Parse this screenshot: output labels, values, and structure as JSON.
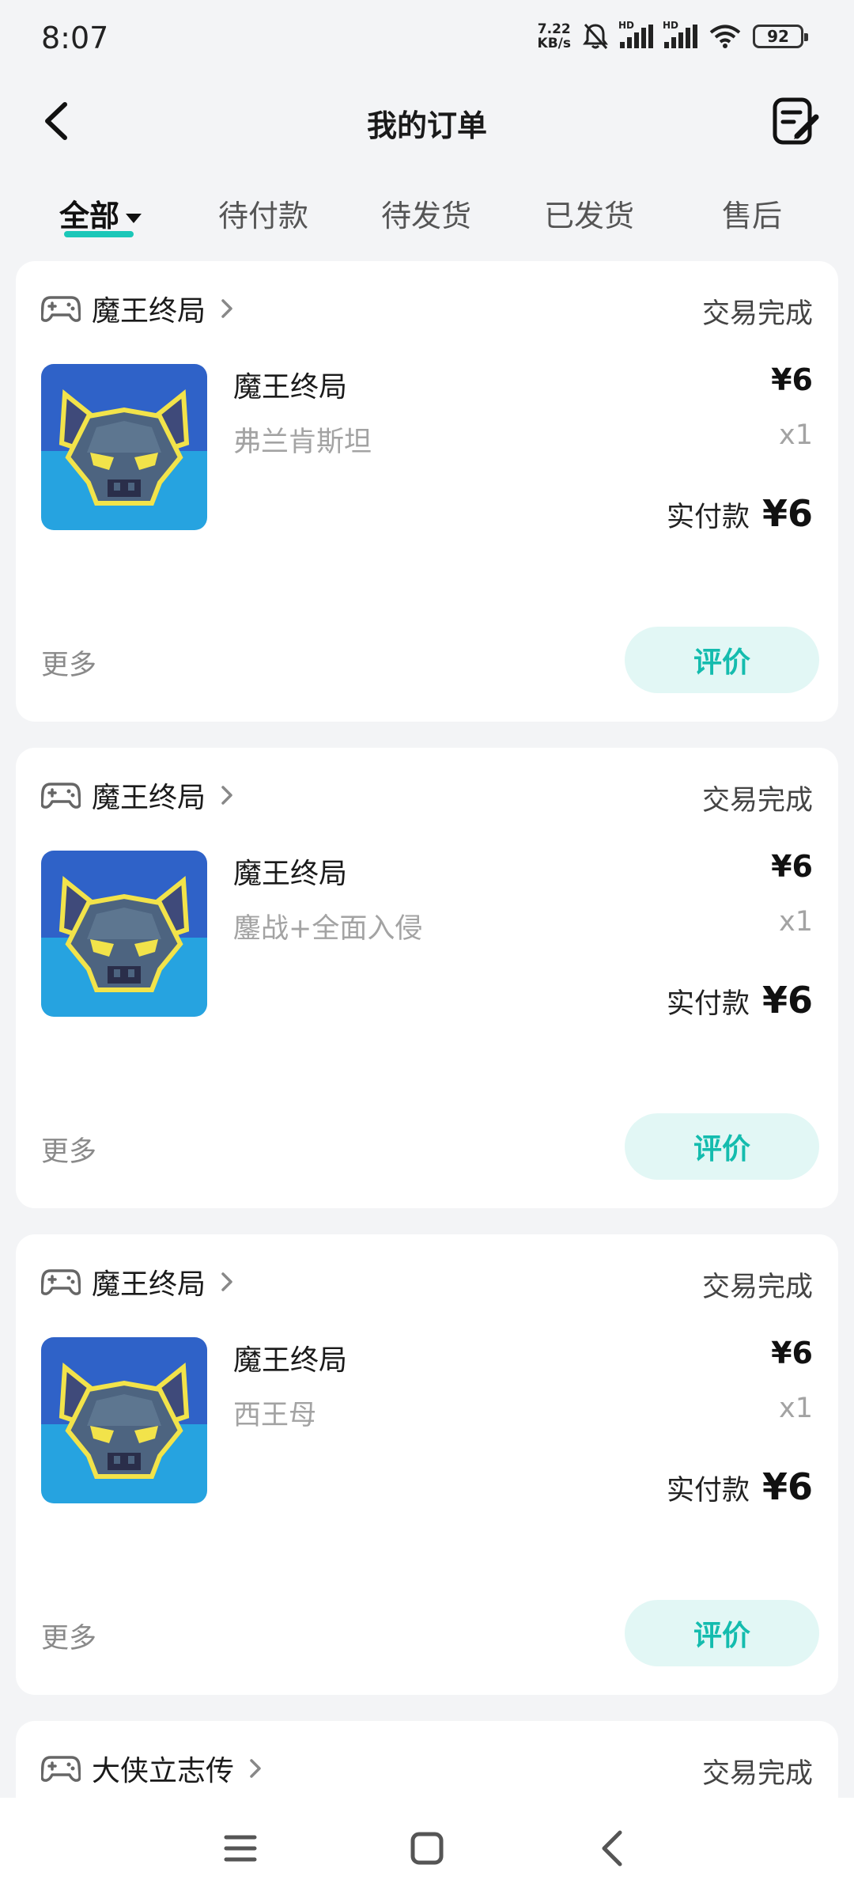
{
  "status_bar": {
    "time": "8:07",
    "net_speed_value": "7.22",
    "net_speed_unit": "KB/s",
    "sig1_label": "HD",
    "sig2_label": "HD",
    "battery": "92",
    "icons": [
      "bell-muted-icon",
      "signal-icon",
      "signal-icon",
      "wifi-icon",
      "battery-icon"
    ]
  },
  "header": {
    "title": "我的订单",
    "back_icon": "back-arrow-icon",
    "edit_icon": "edit-note-icon"
  },
  "tabs": [
    {
      "label": "全部",
      "active": true
    },
    {
      "label": "待付款",
      "active": false
    },
    {
      "label": "待发货",
      "active": false
    },
    {
      "label": "已发货",
      "active": false
    },
    {
      "label": "售后",
      "active": false
    }
  ],
  "orders": [
    {
      "store": "魔王终局",
      "status": "交易完成",
      "product_name": "魔王终局",
      "variant": "弗兰肯斯坦",
      "price": "¥6",
      "quantity": "x1",
      "paid_label": "实付款",
      "paid_amount": "¥6",
      "more_label": "更多",
      "action_label": "评价"
    },
    {
      "store": "魔王终局",
      "status": "交易完成",
      "product_name": "魔王终局",
      "variant": "鏖战+全面入侵",
      "price": "¥6",
      "quantity": "x1",
      "paid_label": "实付款",
      "paid_amount": "¥6",
      "more_label": "更多",
      "action_label": "评价"
    },
    {
      "store": "魔王终局",
      "status": "交易完成",
      "product_name": "魔王终局",
      "variant": "西王母",
      "price": "¥6",
      "quantity": "x1",
      "paid_label": "实付款",
      "paid_amount": "¥6",
      "more_label": "更多",
      "action_label": "评价"
    },
    {
      "store": "大侠立志传",
      "status": "交易完成"
    }
  ],
  "colors": {
    "accent": "#1bc7b8",
    "review_bg": "#e2f7f5",
    "review_text": "#14bcae",
    "page_bg": "#f3f4f6"
  },
  "nav_bar": {
    "icons": [
      "menu-icon",
      "home-icon",
      "back-icon"
    ]
  }
}
